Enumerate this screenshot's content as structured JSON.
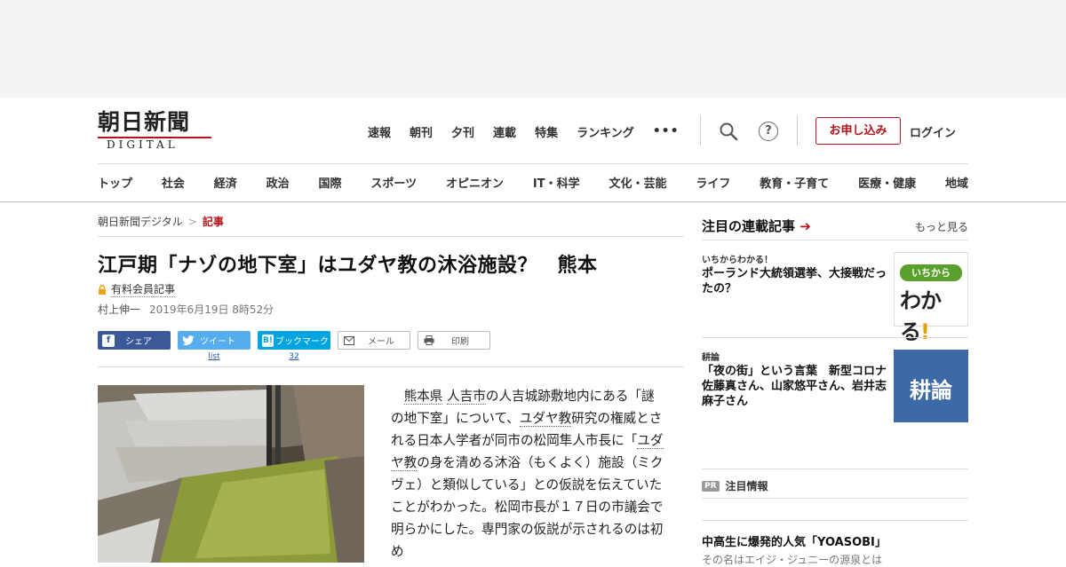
{
  "logo": {
    "jp": "朝日新聞",
    "en": "DIGITAL"
  },
  "topnav": [
    "速報",
    "朝刊",
    "夕刊",
    "連載",
    "特集",
    "ランキング"
  ],
  "topnav_more": "•••",
  "help_label": "?",
  "apply_label": "お申し込み",
  "login_label": "ログイン",
  "catnav": [
    "トップ",
    "社会",
    "経済",
    "政治",
    "国際",
    "スポーツ",
    "オピニオン",
    "IT・科学",
    "文化・芸能",
    "ライフ",
    "教育・子育て",
    "医療・健康",
    "地域"
  ],
  "breadcrumb": {
    "home": "朝日新聞デジタル",
    "sep": ">",
    "current": "記事"
  },
  "article": {
    "title": "江戸期「ナゾの地下室」はユダヤ教の沐浴施設？　熊本",
    "paid_label": "有料会員記事",
    "author": "村上伸一",
    "date": "2019年6月19日 8時52分",
    "body": {
      "p1": "　",
      "link1": "熊本県",
      "link2": "人吉市",
      "t2": "の人吉城跡敷地内にある「謎の地下室」について、",
      "link3": "ユダヤ教",
      "t3": "研究の権威とされる日本人学者が同市の松岡隼人市長に「",
      "link4": "ユダヤ教",
      "t4": "の身を清める沐浴（もくよく）施設（ミクヴェ）と類似している」との仮説を伝えていたことがわかった。松岡市長が１７日の市議会で明らかにした。専門家の仮説が示されるのは初め"
    }
  },
  "share": {
    "facebook": "シェア",
    "twitter": "ツイート",
    "twitter_count": "list",
    "hatena": "ブックマーク",
    "hatena_icon": "B!",
    "hatena_count": "32",
    "mail": "メール",
    "print": "印刷"
  },
  "sidebar": {
    "heading": "注目の連載記事",
    "arrow": "➔",
    "more": "もっと見る",
    "items": [
      {
        "kicker": "いちからわかる！",
        "title": "ポーランド大統領選挙、大接戦だったの？",
        "thumb_text1": "いちから",
        "thumb_text2": "わかる",
        "thumb_text3": "!"
      },
      {
        "kicker": "耕論",
        "title": "「夜の街」という言葉　新型コロナ　佐藤真さん、山家悠平さん、岩井志麻子さん",
        "thumb_text": "耕論"
      }
    ],
    "pr_badge": "PR",
    "pr_label": "注目情報",
    "next_title": "中高生に爆発的人気「YOASOBI」",
    "next_sub": "その名はエイジ・ジュニーの源泉とは"
  },
  "colors": {
    "accent": "#b5121b",
    "facebook": "#3b5998",
    "twitter": "#55acee",
    "hatena": "#00a4de"
  }
}
